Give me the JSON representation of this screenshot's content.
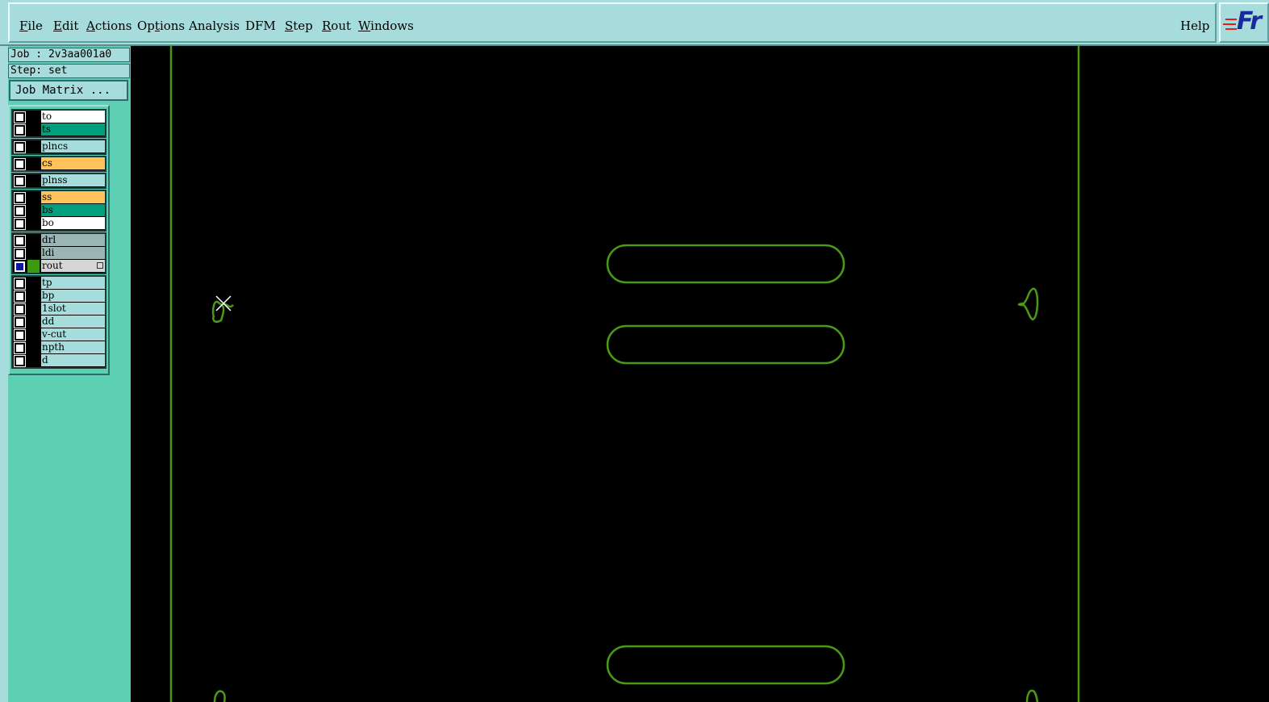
{
  "menubar": {
    "items": [
      {
        "key": "file",
        "mn": "F",
        "rest": "ile"
      },
      {
        "key": "edit",
        "mn": "E",
        "rest": "dit"
      },
      {
        "key": "actions",
        "mn": "A",
        "rest": "ctions"
      },
      {
        "key": "options",
        "pre": "Op",
        "mn": "t",
        "rest": "ions"
      },
      {
        "key": "analysis",
        "mn": "",
        "rest": "Analysis"
      },
      {
        "key": "dfm",
        "mn": "",
        "rest": "DFM"
      },
      {
        "key": "step",
        "mn": "S",
        "rest": "tep"
      },
      {
        "key": "rout",
        "mn": "R",
        "rest": "out"
      },
      {
        "key": "windows",
        "mn": "W",
        "rest": "indows"
      }
    ],
    "help": "Help",
    "logo": "Fr"
  },
  "panel": {
    "job": "Job : 2v3aa001a0",
    "step": "Step: set",
    "job_matrix": "Job Matrix ..."
  },
  "layer_groups": [
    [
      {
        "name": "to",
        "bg": "#ffffff",
        "swatch": "#000000",
        "on": false
      },
      {
        "name": "ts",
        "bg": "#00a07c",
        "swatch": "#000000",
        "on": false
      }
    ],
    [
      {
        "name": "plncs",
        "bg": "#a6dcdc",
        "swatch": "#000000",
        "on": false
      }
    ],
    [
      {
        "name": "cs",
        "bg": "#ffc35a",
        "swatch": "#000000",
        "on": false
      }
    ],
    [
      {
        "name": "plnss",
        "bg": "#a6dcdc",
        "swatch": "#000000",
        "on": false
      }
    ],
    [
      {
        "name": "ss",
        "bg": "#ffc35a",
        "swatch": "#000000",
        "on": false
      },
      {
        "name": "bs",
        "bg": "#00a07c",
        "swatch": "#000000",
        "on": false
      },
      {
        "name": "bo",
        "bg": "#ffffff",
        "swatch": "#000000",
        "on": false
      }
    ],
    [
      {
        "name": "drl",
        "bg": "#9bb4b4",
        "swatch": "#000000",
        "on": false
      },
      {
        "name": "ldi",
        "bg": "#9bb4b4",
        "swatch": "#000000",
        "on": false
      },
      {
        "name": "rout",
        "bg": "#d6d6d6",
        "swatch": "#3c9a12",
        "on": true,
        "marker": true
      }
    ],
    [
      {
        "name": "tp",
        "bg": "#a6dcdc",
        "swatch": "#000000",
        "on": false
      },
      {
        "name": "bp",
        "bg": "#a6dcdc",
        "swatch": "#000000",
        "on": false
      },
      {
        "name": "1slot",
        "bg": "#a6dcdc",
        "swatch": "#000000",
        "on": false
      },
      {
        "name": "dd",
        "bg": "#a6dcdc",
        "swatch": "#000000",
        "on": false
      },
      {
        "name": "v-cut",
        "bg": "#a6dcdc",
        "swatch": "#000000",
        "on": false
      },
      {
        "name": "npth",
        "bg": "#a6dcdc",
        "swatch": "#000000",
        "on": false
      },
      {
        "name": "d",
        "bg": "#a6dcdc",
        "swatch": "#000000",
        "on": false
      }
    ]
  ],
  "canvas": {
    "background": "#000000",
    "stroke_color": "#4a9a14",
    "cursor_color": "#ffffff"
  }
}
